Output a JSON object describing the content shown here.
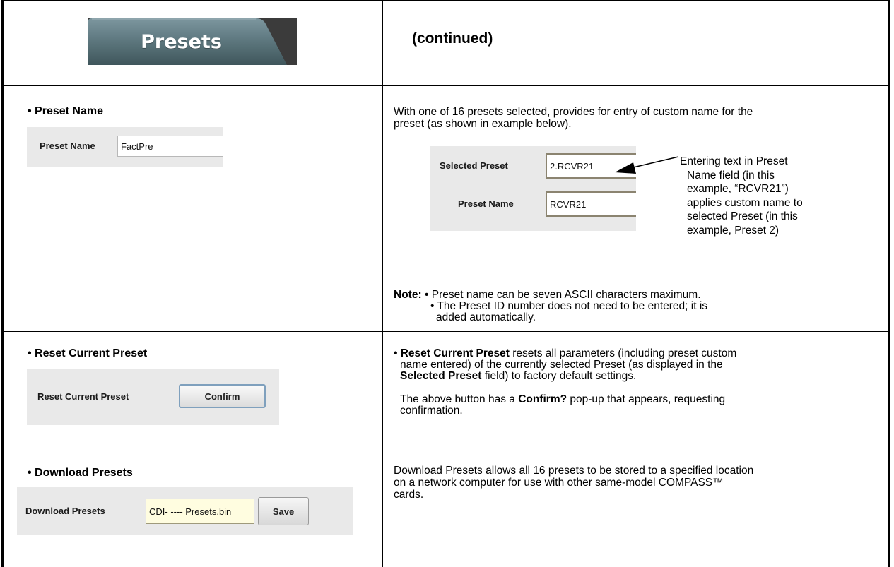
{
  "header": {
    "tab_label": "Presets",
    "continued": "(continued)"
  },
  "preset_name": {
    "bullet": "• Preset Name",
    "ui_label": "Preset Name",
    "ui_value": "FactPre",
    "desc_line1": "With one of 16 presets selected, provides for entry of custom name for the",
    "desc_line2": "preset (as shown in example below).",
    "example": {
      "selected_label": "Selected Preset",
      "selected_value": "2.RCVR21",
      "name_label": "Preset Name",
      "name_value": "RCVR21"
    },
    "callout": [
      "Entering text in Preset",
      "Name field (in this",
      "example, “RCVR21”)",
      "applies custom name to",
      "selected Preset (in this",
      "example, Preset 2)"
    ],
    "note_prefix": "Note:",
    "note1": "• Preset name can be seven ASCII characters maximum.",
    "note2a": "• The Preset ID number does not need to be entered; it is",
    "note2b": "added automatically."
  },
  "reset": {
    "bullet": "• Reset Current Preset",
    "ui_label": "Reset Current Preset",
    "button": "Confirm",
    "d1_bold": "• Reset Current Preset",
    "d1_rest": " resets all parameters (including preset custom",
    "d2": "name entered) of the currently selected Preset (as displayed in the",
    "d3_bold": "Selected Preset",
    "d3_rest": " field) to factory default settings.",
    "d4_pre": "The above button has a ",
    "d4_bold": "Confirm?",
    "d4_post": " pop-up that appears, requesting",
    "d5": "confirmation."
  },
  "download": {
    "bullet": "• Download Presets",
    "ui_label": "Download Presets",
    "ui_value": "CDI- ---- Presets.bin",
    "button": "Save",
    "d1": "Download Presets allows all 16 presets to be stored to a specified location",
    "d2": "on a network computer for use with other same-model COMPASS™",
    "d3": "cards."
  },
  "colors": {
    "tab_top": "#6f8b94",
    "tab_bottom": "#456067",
    "panel_bg": "#e9e9e9"
  }
}
